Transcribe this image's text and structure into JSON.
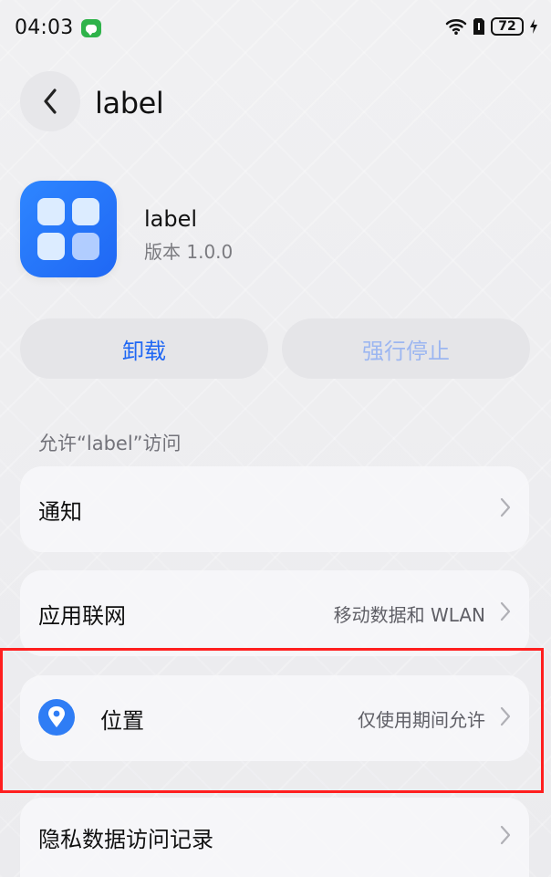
{
  "status_bar": {
    "time": "04:03",
    "battery_level": "72"
  },
  "header": {
    "title": "label"
  },
  "app": {
    "name": "label",
    "version": "版本 1.0.0"
  },
  "actions": {
    "uninstall": "卸载",
    "force_stop": "强行停止"
  },
  "permissions": {
    "section_label": "允许“label”访问",
    "notification": "通知",
    "network": {
      "label": "应用联网",
      "value": "移动数据和 WLAN"
    },
    "location": {
      "label": "位置",
      "value": "仅使用期间允许"
    },
    "privacy_record": "隐私数据访问记录"
  },
  "colors": {
    "accent": "#1f67f4",
    "highlight": "#ff1f1f"
  },
  "icons": {
    "back": "chevron-left-icon",
    "location": "location-pin-icon"
  }
}
